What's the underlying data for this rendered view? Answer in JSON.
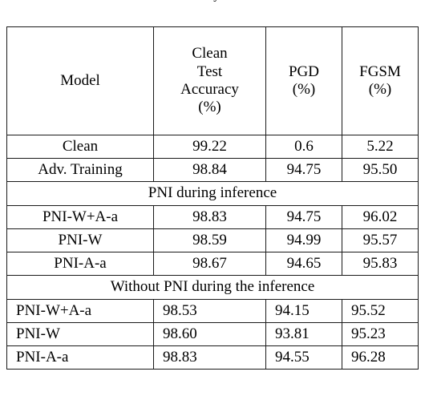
{
  "caption": {
    "clipped_text": "y"
  },
  "table": {
    "columns": [
      {
        "key": "model",
        "header_lines": [
          "Model"
        ]
      },
      {
        "key": "clean_test_accuracy",
        "header_lines": [
          "Clean",
          "Test",
          "Accuracy",
          "(%)"
        ]
      },
      {
        "key": "pgd",
        "header_lines": [
          "PGD",
          "(%)"
        ]
      },
      {
        "key": "fgsm",
        "header_lines": [
          "FGSM",
          "(%)"
        ]
      }
    ],
    "rows": [
      {
        "type": "data",
        "align": "center",
        "cells": [
          "Clean",
          "99.22",
          "0.6",
          "5.22"
        ]
      },
      {
        "type": "data",
        "align": "center",
        "cells": [
          "Adv. Training",
          "98.84",
          "94.75",
          "95.50"
        ]
      },
      {
        "type": "section",
        "label": "PNI during inference"
      },
      {
        "type": "data",
        "align": "center",
        "cells": [
          "PNI-W+A-a",
          "98.83",
          "94.75",
          "96.02"
        ]
      },
      {
        "type": "data",
        "align": "center",
        "cells": [
          "PNI-W",
          "98.59",
          "94.99",
          "95.57"
        ]
      },
      {
        "type": "data",
        "align": "center",
        "cells": [
          "PNI-A-a",
          "98.67",
          "94.65",
          "95.83"
        ]
      },
      {
        "type": "section",
        "label": "Without PNI during the inference"
      },
      {
        "type": "data",
        "align": "left",
        "cells": [
          "PNI-W+A-a",
          "98.53",
          "94.15",
          "95.52"
        ]
      },
      {
        "type": "data",
        "align": "left",
        "cells": [
          "PNI-W",
          "98.60",
          "93.81",
          "95.23"
        ]
      },
      {
        "type": "data",
        "align": "left",
        "cells": [
          "PNI-A-a",
          "98.83",
          "94.55",
          "96.28"
        ]
      }
    ]
  },
  "style": {
    "border_color": "#1a1a1a",
    "text_color": "#000000",
    "background": "#ffffff"
  }
}
